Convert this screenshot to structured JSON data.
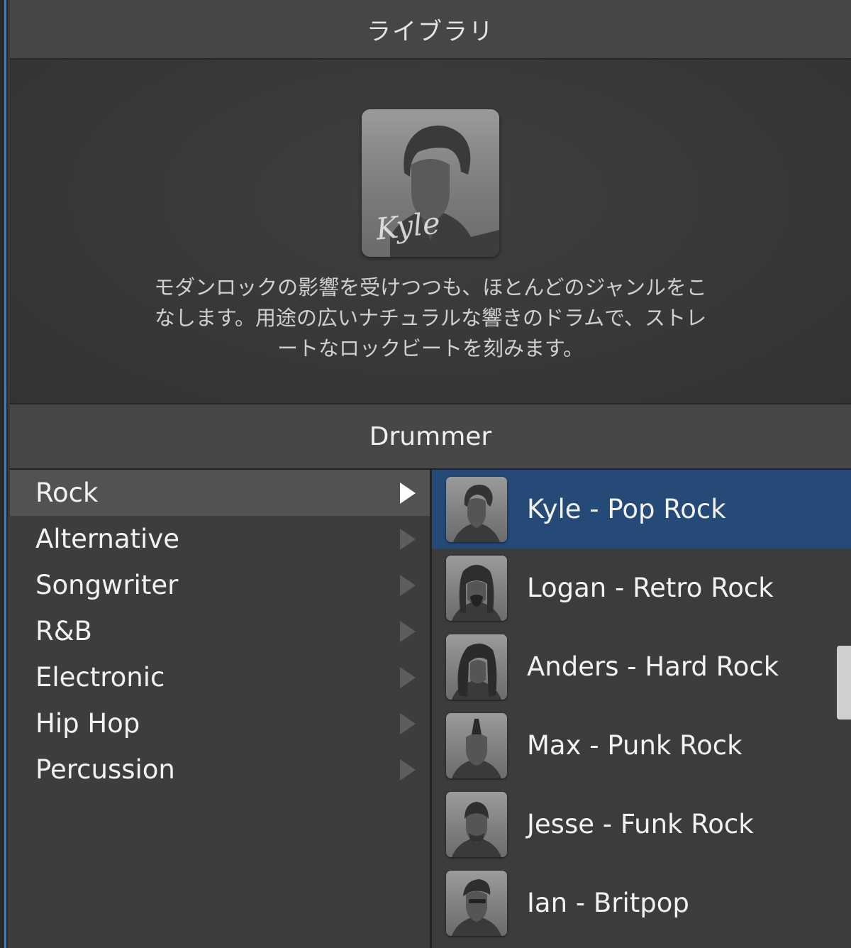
{
  "library": {
    "title": "ライブラリ"
  },
  "selected_drummer": {
    "signature": "Kyle",
    "description_lines": [
      "モダンロックの影響を受けつつも、ほとんどのジャンルをこ",
      "なします。用途の広いナチュラルな響きのドラムで、ストレ",
      "ートなロックビートを刻みます。"
    ]
  },
  "section": {
    "title": "Drummer"
  },
  "genres": [
    {
      "label": "Rock",
      "selected": true
    },
    {
      "label": "Alternative",
      "selected": false
    },
    {
      "label": "Songwriter",
      "selected": false
    },
    {
      "label": "R&B",
      "selected": false
    },
    {
      "label": "Electronic",
      "selected": false
    },
    {
      "label": "Hip Hop",
      "selected": false
    },
    {
      "label": "Percussion",
      "selected": false
    }
  ],
  "drummers": [
    {
      "label": "Kyle - Pop Rock",
      "selected": true
    },
    {
      "label": "Logan - Retro Rock",
      "selected": false
    },
    {
      "label": "Anders - Hard Rock",
      "selected": false
    },
    {
      "label": "Max - Punk Rock",
      "selected": false
    },
    {
      "label": "Jesse - Funk Rock",
      "selected": false
    },
    {
      "label": "Ian - Britpop",
      "selected": false
    }
  ],
  "colors": {
    "selection_blue": "#254a78",
    "panel_bg": "#3b3b3b",
    "header_bg": "#474747"
  },
  "icons": {
    "genre_arrow": "disclosure-triangle-right",
    "avatar": "drummer-silhouette"
  }
}
